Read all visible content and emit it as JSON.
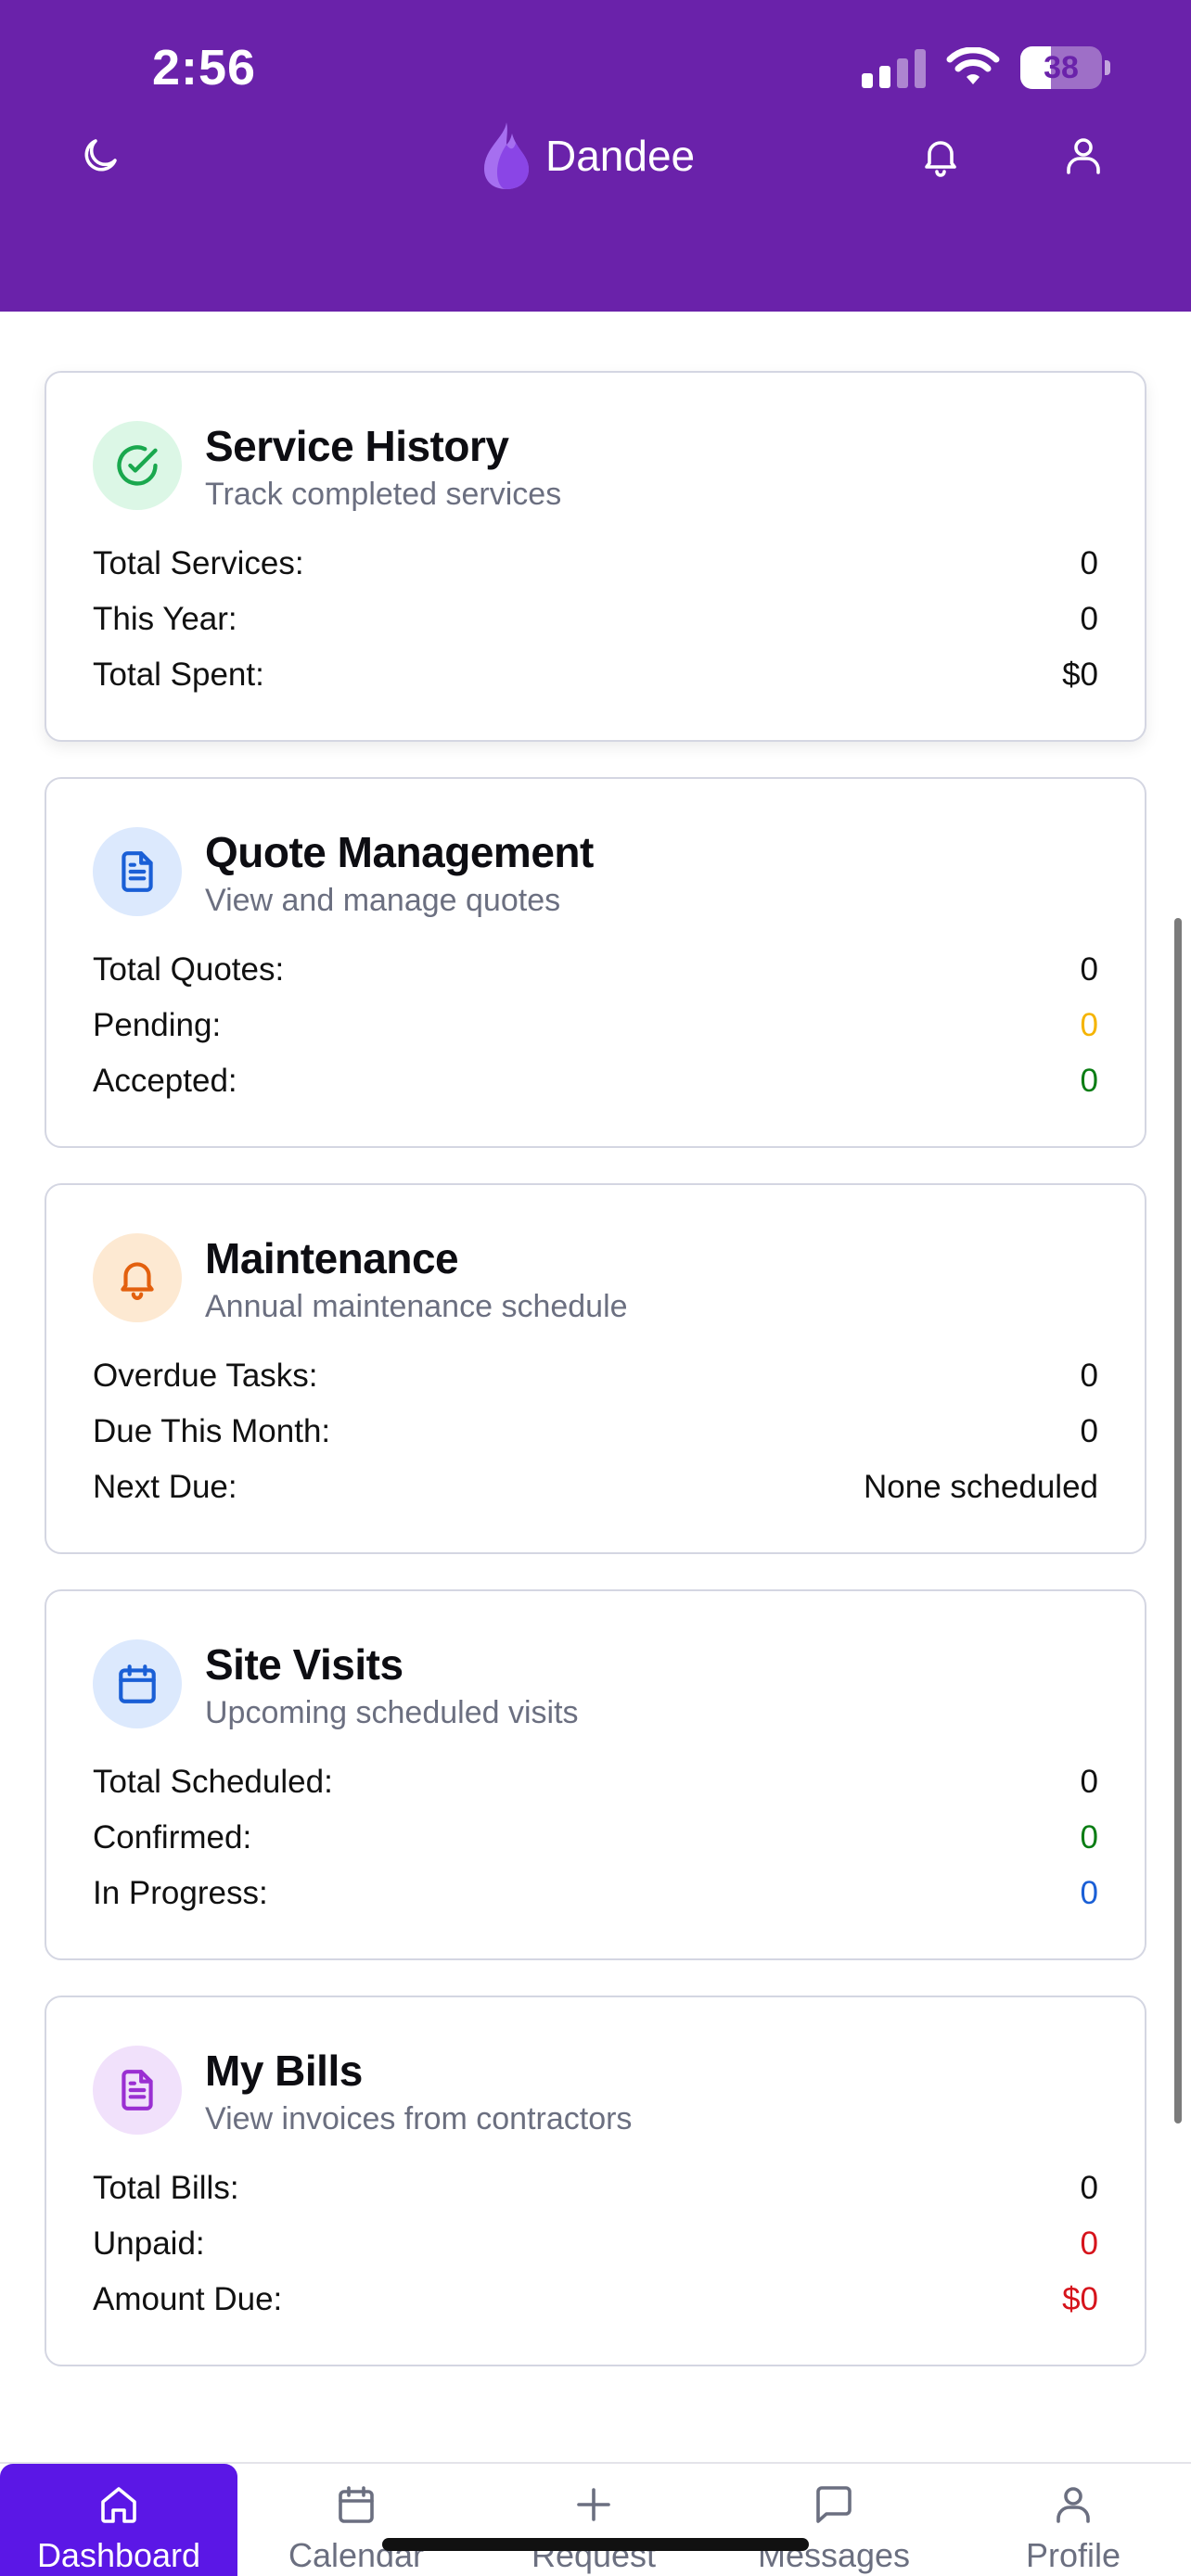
{
  "status_bar": {
    "time": "2:56",
    "battery": "38"
  },
  "header": {
    "brand": "Dandee"
  },
  "cards": [
    {
      "title": "Service History",
      "subtitle": "Track completed services",
      "icon": "check-circle-icon",
      "rows": [
        {
          "label": "Total Services:",
          "value": "0"
        },
        {
          "label": "This Year:",
          "value": "0"
        },
        {
          "label": "Total Spent:",
          "value": "$0"
        }
      ]
    },
    {
      "title": "Quote Management",
      "subtitle": "View and manage quotes",
      "icon": "document-icon",
      "rows": [
        {
          "label": "Total Quotes:",
          "value": "0"
        },
        {
          "label": "Pending:",
          "value": "0"
        },
        {
          "label": "Accepted:",
          "value": "0"
        }
      ]
    },
    {
      "title": "Maintenance",
      "subtitle": "Annual maintenance schedule",
      "icon": "bell-icon",
      "rows": [
        {
          "label": "Overdue Tasks:",
          "value": "0"
        },
        {
          "label": "Due This Month:",
          "value": "0"
        },
        {
          "label": "Next Due:",
          "value": "None scheduled"
        }
      ]
    },
    {
      "title": "Site Visits",
      "subtitle": "Upcoming scheduled visits",
      "icon": "calendar-icon",
      "rows": [
        {
          "label": "Total Scheduled:",
          "value": "0"
        },
        {
          "label": "Confirmed:",
          "value": "0"
        },
        {
          "label": "In Progress:",
          "value": "0"
        }
      ]
    },
    {
      "title": "My Bills",
      "subtitle": "View invoices from contractors",
      "icon": "invoice-icon",
      "rows": [
        {
          "label": "Total Bills:",
          "value": "0"
        },
        {
          "label": "Unpaid:",
          "value": "0"
        },
        {
          "label": "Amount Due:",
          "value": "$0"
        }
      ]
    }
  ],
  "colors": {
    "header_bg": "#6a22aa",
    "nav_active": "#5b17e6",
    "pending": "#f5b400",
    "success": "#0a7d14",
    "info": "#1a5fd6",
    "danger": "#d6141c"
  },
  "bottom_nav": [
    {
      "label": "Dashboard",
      "icon": "home-icon",
      "active": true
    },
    {
      "label": "Calendar",
      "icon": "calendar-icon"
    },
    {
      "label": "Request",
      "icon": "plus-icon"
    },
    {
      "label": "Messages",
      "icon": "message-icon"
    },
    {
      "label": "Profile",
      "icon": "user-icon"
    }
  ]
}
